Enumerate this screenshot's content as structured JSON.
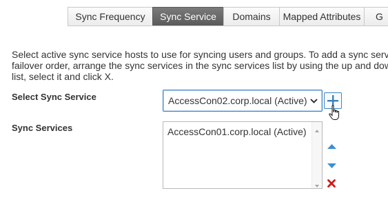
{
  "tabs": [
    {
      "label": "Sync Frequency",
      "active": false
    },
    {
      "label": "Sync Service",
      "active": true
    },
    {
      "label": "Domains",
      "active": false
    },
    {
      "label": "Mapped Attributes",
      "active": false
    },
    {
      "label": "G",
      "active": false
    }
  ],
  "description": {
    "line1": "Select active sync service hosts to use for syncing users and groups. To add a sync serv",
    "line2": "failover order, arrange the sync services in the sync services list by using the up and dow",
    "line3": "list, select it and click X."
  },
  "select_sync_service": {
    "label": "Select Sync Service",
    "selected_value": "AccessCon02.corp.local (Active)",
    "add_icon": "plus-icon"
  },
  "sync_services": {
    "label": "Sync Services",
    "items": [
      "AccessCon01.corp.local (Active)"
    ],
    "move_up_icon": "triangle-up-icon",
    "move_down_icon": "triangle-down-icon",
    "remove_icon": "x-icon"
  },
  "colors": {
    "active_tab": "#666666",
    "accent_blue": "#3b82c4",
    "arrow_blue": "#3d8fd0",
    "remove_red": "#d21a1a"
  }
}
